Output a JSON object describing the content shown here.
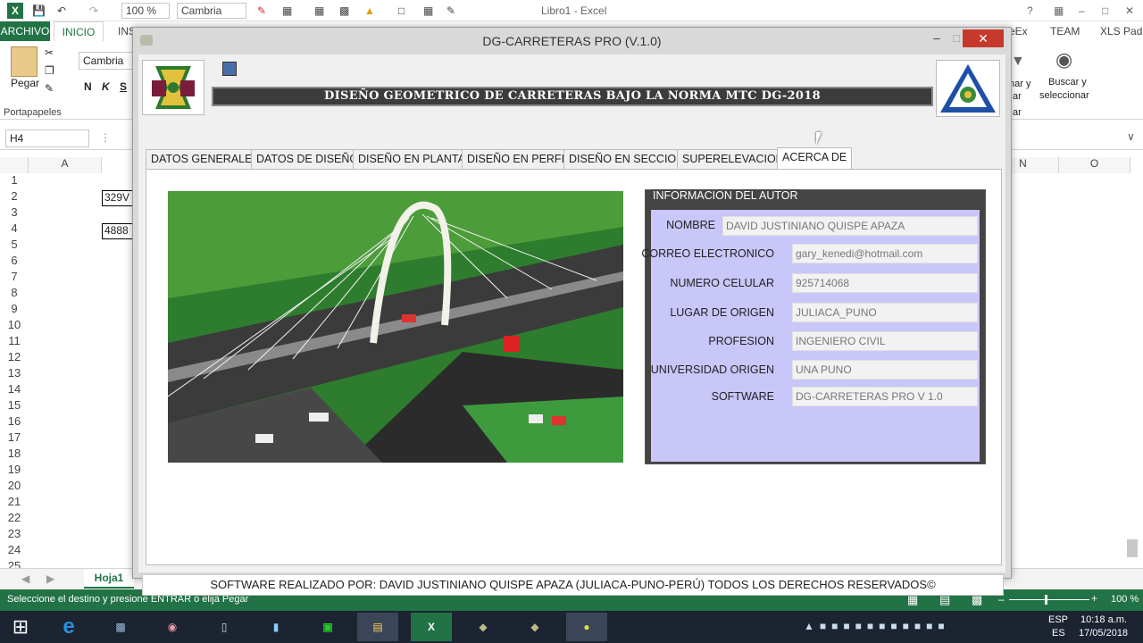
{
  "excel": {
    "window_title": "Libro1 - Excel",
    "zoom": "100 %",
    "font_name": "Cambria",
    "ribbon_tabs": [
      "ARCHIVO",
      "INICIO",
      "INS",
      "eEx",
      "TEAM",
      "XLS Pad"
    ],
    "ribbon": {
      "paste_label": "Pegar",
      "font_box": "Cambria",
      "clipboard_label": "Portapapeles",
      "buscar_label": "Buscar y",
      "seleccionar_label": "seleccionar",
      "ordenar_label": "nar y",
      "filtrar_label": "ar",
      "modificar_label": "ar"
    },
    "name_box": "H4",
    "columns": [
      "A",
      "N",
      "O"
    ],
    "rows": [
      "1",
      "2",
      "3",
      "4",
      "5",
      "6",
      "7",
      "8",
      "9",
      "10",
      "11",
      "12",
      "13",
      "14",
      "15",
      "16",
      "17",
      "18",
      "19",
      "20",
      "21",
      "22",
      "23",
      "24",
      "25"
    ],
    "cell_b2": "329V",
    "cell_b4": "4888",
    "sheet_tab": "Hoja1",
    "status_text": "Seleccione el destino y presione ENTRAR o elija Pegar",
    "status_zoom": "100 %"
  },
  "dialog": {
    "title": "DG-CARRETERAS PRO (V.1.0)",
    "banner": "DISEÑO GEOMETRICO DE CARRETERAS BAJO LA NORMA MTC DG-2018",
    "tabs": [
      "DATOS GENERALES",
      "DATOS DE DISEÑO",
      "DISEÑO EN PLANTA",
      "DISEÑO EN PERFIL",
      "DISEÑO EN SECCION",
      "SUPERELEVACION",
      "ACERCA DE"
    ],
    "selected_tab": "ACERCA DE",
    "info_title": "INFORMACION DEL AUTOR",
    "fields": [
      {
        "label": "NOMBRE",
        "value": "DAVID JUSTINIANO QUISPE APAZA"
      },
      {
        "label": "CORREO ELECTRONICO",
        "value": "gary_kenedi@hotmail.com"
      },
      {
        "label": "NUMERO CELULAR",
        "value": "925714068"
      },
      {
        "label": "LUGAR DE ORIGEN",
        "value": "JULIACA_PUNO"
      },
      {
        "label": "PROFESION",
        "value": "INGENIERO CIVIL"
      },
      {
        "label": "UNIVERSIDAD ORIGEN",
        "value": "UNA PUNO"
      },
      {
        "label": "SOFTWARE",
        "value": "DG-CARRETERAS PRO V 1.0"
      }
    ],
    "footer": "SOFTWARE REALIZADO POR: DAVID JUSTINIANO QUISPE APAZA (JULIACA-PUNO-PERÚ) TODOS LOS DERECHOS RESERVADOS©"
  },
  "taskbar": {
    "lang": "ESP",
    "lang2": "ES",
    "time": "10:18 a.m.",
    "date": "17/05/2018"
  },
  "colors": {
    "excel_green": "#217346",
    "close_red": "#c7392b",
    "info_bg": "#c9c6f9",
    "banner_bg": "#3c3c3c"
  }
}
